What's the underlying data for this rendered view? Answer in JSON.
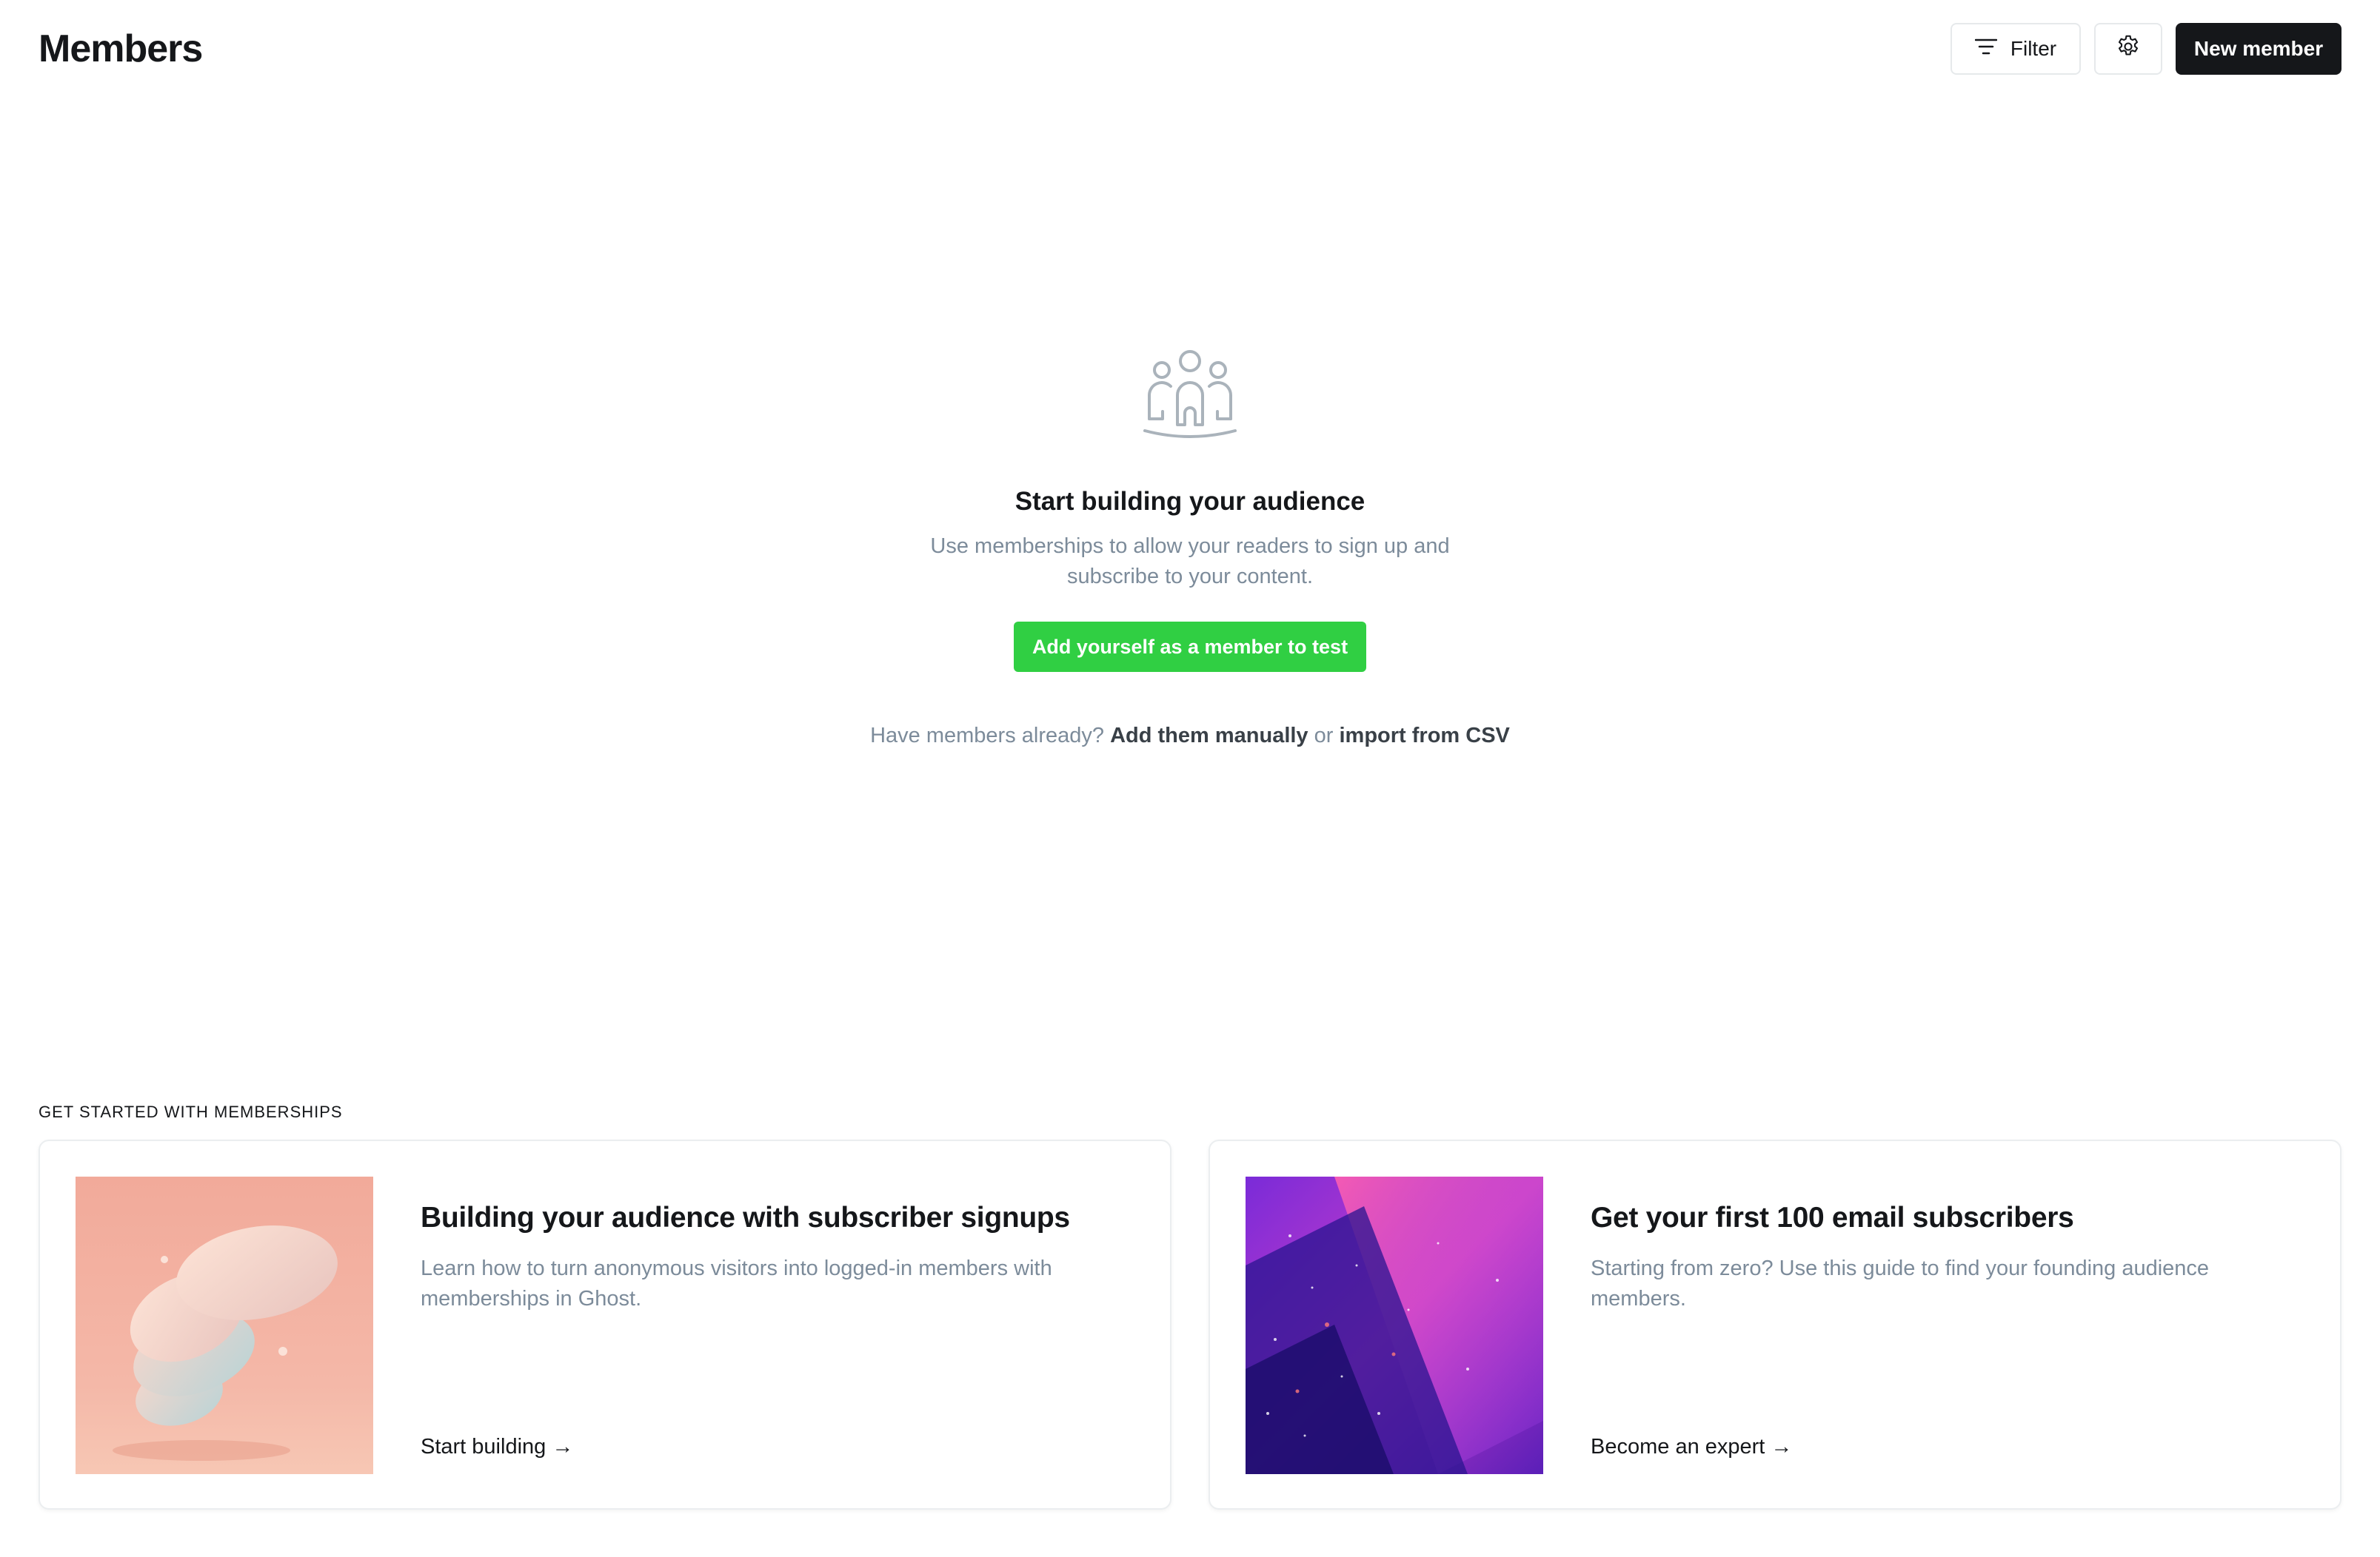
{
  "header": {
    "title": "Members",
    "filter_label": "Filter",
    "filter_icon": "filter-lines-icon",
    "settings_icon": "gear-icon",
    "new_member_label": "New member"
  },
  "empty_state": {
    "icon": "members-group-icon",
    "title": "Start building your audience",
    "description": "Use memberships to allow your readers to sign up and subscribe to your content.",
    "cta_label": "Add yourself as a member to test",
    "cta_color": "#30cf43",
    "have_members_prefix": "Have members already?",
    "add_manually_label": "Add them manually",
    "or_text": "or",
    "import_csv_label": "import from CSV"
  },
  "get_started": {
    "label": "GET STARTED WITH MEMBERSHIPS",
    "cards": [
      {
        "title": "Building your audience with subscriber signups",
        "description": "Learn how to turn anonymous visitors into logged-in members with memberships in Ghost.",
        "link_label": "Start building →"
      },
      {
        "title": "Get your first 100 email subscribers",
        "description": "Starting from zero? Use this guide to find your founding audience members.",
        "link_label": "Become an expert →"
      }
    ]
  }
}
